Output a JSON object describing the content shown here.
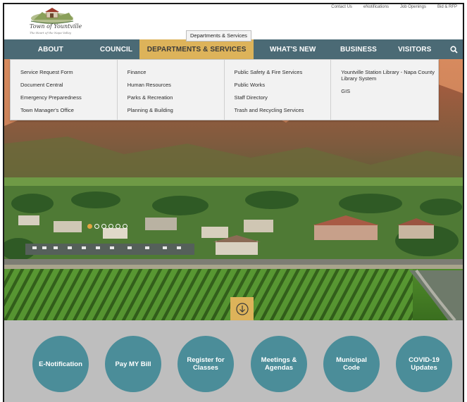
{
  "logo": {
    "title": "Town of Yountville",
    "tagline": "The Heart of the Napa Valley"
  },
  "top_links": [
    "Contact Us",
    "eNotifications",
    "Job Openings",
    "Bid & RFP"
  ],
  "tooltip": "Departments & Services",
  "nav": {
    "items": [
      "ABOUT",
      "COUNCIL",
      "DEPARTMENTS & SERVICES",
      "WHAT'S NEW",
      "BUSINESS",
      "VISITORS"
    ],
    "active": "DEPARTMENTS & SERVICES"
  },
  "dropdown": {
    "columns": [
      [
        "Service Request Form",
        "Document Central",
        "Emergency Preparedness",
        "Town Manager's Office"
      ],
      [
        "Finance",
        "Human Resources",
        "Parks & Recreation",
        "Planning & Building"
      ],
      [
        "Public Safety & Fire Services",
        "Public Works",
        "Staff Directory",
        "Trash and Recycling Services"
      ],
      [
        "Yountville Station Library - Napa County Library System",
        "GIS"
      ]
    ]
  },
  "slider": {
    "total": 6,
    "active": 1
  },
  "quick_links": [
    "E-Notification",
    "Pay MY Bill",
    "Register for Classes",
    "Meetings & Agendas",
    "Municipal Code",
    "COVID-19 Updates"
  ],
  "colors": {
    "nav_bg": "#4b6a75",
    "nav_active": "#ddb35a",
    "circle": "#4b8d99",
    "band": "#bebebe"
  }
}
